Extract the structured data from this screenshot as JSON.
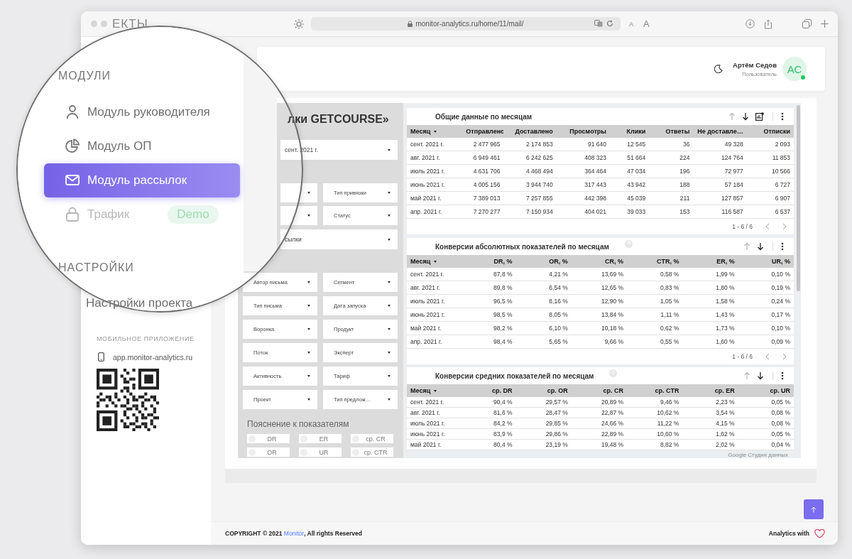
{
  "browser": {
    "url": "monitor-analytics.ru/home/11/mail/",
    "text_small": "A",
    "text_large": "A"
  },
  "magnifier": {
    "cut_heading": "ЕКТЫ",
    "sections": [
      {
        "heading": "МОДУЛИ",
        "items": [
          {
            "label": "Модуль руководителя",
            "kind": "person",
            "selected": false,
            "disabled": false
          },
          {
            "label": "Модуль ОП",
            "kind": "pie",
            "selected": false,
            "disabled": false
          },
          {
            "label": "Модуль рассылок",
            "kind": "mail",
            "selected": true,
            "disabled": false
          },
          {
            "label": "Трафик",
            "kind": "lock",
            "selected": false,
            "disabled": true,
            "badge": "Demo"
          }
        ]
      },
      {
        "heading": "НАСТРОЙКИ"
      }
    ],
    "cut_item": "Настройки проекта"
  },
  "sidebar": {
    "mobile_heading": "МОБИЛЬНОЕ ПРИЛОЖЕНИЕ",
    "app_link": "app.monitor-analytics.ru"
  },
  "header": {
    "user_name": "Артём Седов",
    "user_role": "Пользователь",
    "avatar_initials": "АС",
    "online": true
  },
  "report": {
    "title_fragment": "лки GETCOURSE»",
    "top_filters": [
      {
        "kind": "wide",
        "label": "сент. 2021 г."
      },
      {
        "kind": "pair",
        "right": "Тип привязки"
      },
      {
        "kind": "pair",
        "right": "Статус"
      },
      {
        "kind": "wide",
        "label": "сылки"
      }
    ],
    "filters": [
      "Автор письма",
      "Сегмент",
      "Тип письма",
      "Дата запуска",
      "Воронка",
      "Продукт",
      "Поток",
      "Эксперт",
      "Активность",
      "Тариф",
      "Проект",
      "Тип предлож…"
    ],
    "legend_title": "Пояснение к показателям",
    "legend": [
      "DR",
      "ER",
      "ср. CR",
      "OR",
      "UR",
      "ср. CTR"
    ],
    "tables": [
      {
        "title": "Общие данные по месяцам",
        "help": false,
        "kind": "wide",
        "tools": [
          {
            "kind": "sort-up",
            "disabled": true
          },
          {
            "kind": "sort-down",
            "disabled": false
          },
          {
            "kind": "chart",
            "disabled": false
          },
          {
            "kind": "more",
            "disabled": false
          }
        ],
        "columns": [
          "Месяц",
          "Отправлено",
          "Доставлено",
          "Просмотры",
          "Клики",
          "Ответы",
          "Не доставле…",
          "Отписки"
        ],
        "rows": [
          [
            "сент. 2021 г.",
            "2 477 965",
            "2 174 853",
            "91 640",
            "12 545",
            "36",
            "49 328",
            "2 093"
          ],
          [
            "авг. 2021 г.",
            "6 949 461",
            "6 242 625",
            "408 323",
            "51 664",
            "224",
            "124 764",
            "11 853"
          ],
          [
            "июль 2021 г.",
            "4 631 706",
            "4 468 494",
            "364 464",
            "47 034",
            "196",
            "72 977",
            "10 566"
          ],
          [
            "июнь 2021 г.",
            "4 005 156",
            "3 944 740",
            "317 443",
            "43 942",
            "188",
            "57 184",
            "6 727"
          ],
          [
            "май 2021 г.",
            "7 389 013",
            "7 257 855",
            "442 398",
            "45 039",
            "211",
            "127 857",
            "6 907"
          ],
          [
            "апр. 2021 г.",
            "7 270 277",
            "7 150 934",
            "404 021",
            "39 033",
            "153",
            "116 587",
            "6 537"
          ]
        ],
        "pagination": "1 - 6 / 6"
      },
      {
        "title": "Конверсии абсолютных показателей по месяцам",
        "help": true,
        "kind": "narrow",
        "tools": [
          {
            "kind": "sort-up",
            "disabled": true
          },
          {
            "kind": "sort-down",
            "disabled": false
          },
          {
            "kind": "more",
            "disabled": false
          }
        ],
        "columns": [
          "Месяц",
          "DR, %",
          "OR, %",
          "CR, %",
          "CTR, %",
          "ER, %",
          "UR, %"
        ],
        "rows": [
          [
            "сент. 2021 г.",
            "87,8 %",
            "4,21 %",
            "13,69 %",
            "0,58 %",
            "1,99 %",
            "0,10 %"
          ],
          [
            "авг. 2021 г.",
            "89,8 %",
            "6,54 %",
            "12,65 %",
            "0,83 %",
            "1,80 %",
            "0,19 %"
          ],
          [
            "июль 2021 г.",
            "96,5 %",
            "8,16 %",
            "12,90 %",
            "1,05 %",
            "1,58 %",
            "0,24 %"
          ],
          [
            "июнь 2021 г.",
            "98,5 %",
            "8,05 %",
            "13,84 %",
            "1,11 %",
            "1,43 %",
            "0,17 %"
          ],
          [
            "май 2021 г.",
            "98,2 %",
            "6,10 %",
            "10,18 %",
            "0,62 %",
            "1,73 %",
            "0,10 %"
          ],
          [
            "апр. 2021 г.",
            "98,4 %",
            "5,65 %",
            "9,66 %",
            "0,55 %",
            "1,60 %",
            "0,09 %"
          ]
        ],
        "pagination": "1 - 6 / 6"
      },
      {
        "title": "Конверсии средних показателей по месяцам",
        "help": true,
        "kind": "narrow",
        "tools": [
          {
            "kind": "sort-up",
            "disabled": true
          },
          {
            "kind": "sort-down",
            "disabled": false
          },
          {
            "kind": "more",
            "disabled": false
          }
        ],
        "columns": [
          "Месяц",
          "ср. DR",
          "ср. OR",
          "ср. CR",
          "ср. CTR",
          "ср. ER",
          "ср. UR"
        ],
        "rows": [
          [
            "сент. 2021 г.",
            "90,4 %",
            "29,57 %",
            "20,89 %",
            "9,46 %",
            "2,23 %",
            "0,05 %"
          ],
          [
            "авг. 2021 г.",
            "81,6 %",
            "28,47 %",
            "22,87 %",
            "10,62 %",
            "3,54 %",
            "0,08 %"
          ],
          [
            "июль 2021 г.",
            "84,2 %",
            "29,85 %",
            "24,66 %",
            "11,22 %",
            "4,15 %",
            "0,08 %"
          ],
          [
            "июнь 2021 г.",
            "83,9 %",
            "29,86 %",
            "22,89 %",
            "10,60 %",
            "1,62 %",
            "0,05 %"
          ],
          [
            "май 2021 г.",
            "80,4 %",
            "23,19 %",
            "19,48 %",
            "8,82 %",
            "2,02 %",
            "0,04 %"
          ]
        ]
      }
    ],
    "watermark": "Google Студия данных"
  },
  "footer": {
    "copyright": "COPYRIGHT © 2021 ",
    "brand": "Monitor",
    "rights": ", All rights Reserved",
    "analytics": "Analytics with"
  }
}
